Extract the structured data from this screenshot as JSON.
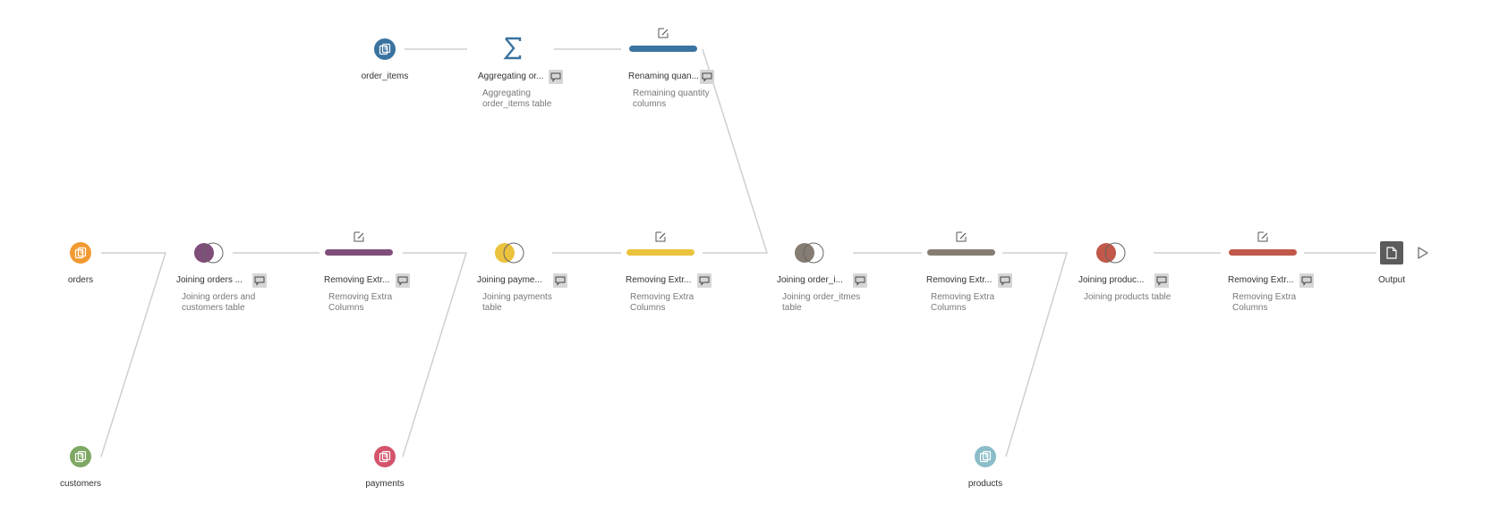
{
  "colors": {
    "orders": "#f29a32",
    "customers": "#7ea863",
    "order_items": "#3a73a0",
    "payments": "#d4546c",
    "products": "#8bbcc9",
    "purple": "#7f4e7a",
    "yellow": "#ebc23d",
    "gray": "#857d73",
    "rust": "#c1584a",
    "output": "#5b5b5b",
    "link": "#cfcfcf"
  },
  "inputs": {
    "orders": {
      "label": "orders",
      "icon": "data-source-icon"
    },
    "customers": {
      "label": "customers",
      "icon": "data-source-icon"
    },
    "order_items": {
      "label": "order_items",
      "icon": "data-source-icon"
    },
    "payments": {
      "label": "payments",
      "icon": "data-source-icon"
    },
    "products": {
      "label": "products",
      "icon": "data-source-icon"
    }
  },
  "steps": {
    "join_orders": {
      "label": "Joining orders ...",
      "description": "Joining orders and customers table",
      "icon": "join-icon"
    },
    "clean_1": {
      "label": "Removing Extr...",
      "description": "Removing Extra Columns",
      "icon": "clean-step-icon"
    },
    "join_payments": {
      "label": "Joining payme...",
      "description": "Joining payments table",
      "icon": "join-icon"
    },
    "clean_2": {
      "label": "Removing Extr...",
      "description": "Removing Extra Columns",
      "icon": "clean-step-icon"
    },
    "join_order_items": {
      "label": "Joining order_i...",
      "description": "Joining order_itmes table",
      "icon": "join-icon"
    },
    "clean_3": {
      "label": "Removing Extr...",
      "description": "Removing Extra Columns",
      "icon": "clean-step-icon"
    },
    "join_products": {
      "label": "Joining produc...",
      "description": "Joining products table",
      "icon": "join-icon"
    },
    "clean_4": {
      "label": "Removing Extr...",
      "description": "Removing Extra Columns",
      "icon": "clean-step-icon"
    },
    "aggregate": {
      "label": "Aggregating or...",
      "description": "Aggregating order_items table",
      "icon": "sigma-icon"
    },
    "rename": {
      "label": "Renaming quan...",
      "description": "Remaining quantity columns",
      "icon": "clean-step-icon"
    }
  },
  "output": {
    "label": "Output",
    "icon": "output-file-icon",
    "run_icon": "play-icon"
  }
}
